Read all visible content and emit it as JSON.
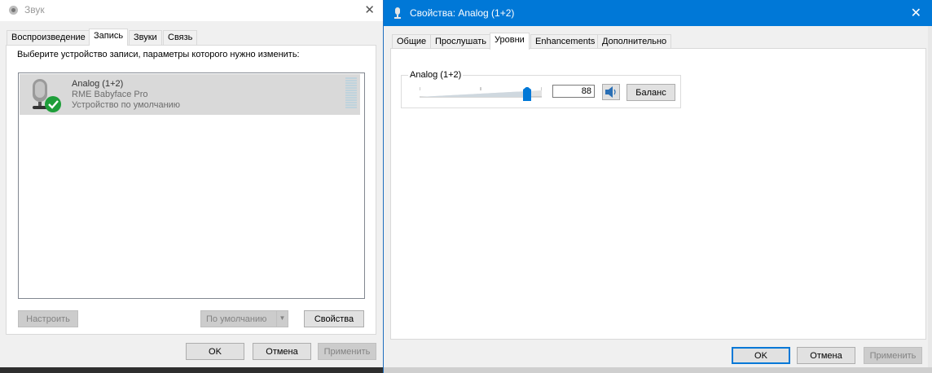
{
  "sound_window": {
    "title": "Звук",
    "tabs": [
      {
        "label": "Воспроизведение"
      },
      {
        "label": "Запись"
      },
      {
        "label": "Звуки"
      },
      {
        "label": "Связь"
      }
    ],
    "instruction": "Выберите устройство записи, параметры которого нужно изменить:",
    "device": {
      "name": "Analog (1+2)",
      "model": "RME Babyface Pro",
      "status": "Устройство по умолчанию",
      "icon": "microphone-icon",
      "default_badge": "check-badge-icon"
    },
    "buttons": {
      "configure": "Настроить",
      "set_default": "По умолчанию",
      "properties": "Свойства",
      "ok": "OK",
      "cancel": "Отмена",
      "apply": "Применить"
    }
  },
  "properties_window": {
    "title": "Свойства: Analog (1+2)",
    "tabs": [
      {
        "label": "Общие"
      },
      {
        "label": "Прослушать"
      },
      {
        "label": "Уровни"
      },
      {
        "label": "Enhancements"
      },
      {
        "label": "Дополнительно"
      }
    ],
    "levels": {
      "group_label": "Analog (1+2)",
      "level_value": "88",
      "level_fraction": 0.88,
      "balance_label": "Баланс",
      "mute_icon": "speaker-icon"
    },
    "buttons": {
      "ok": "OK",
      "cancel": "Отмена",
      "apply": "Применить"
    }
  },
  "colors": {
    "accent": "#0078d7",
    "selection": "#d9d9d9",
    "check_green": "#1e9e3a"
  }
}
